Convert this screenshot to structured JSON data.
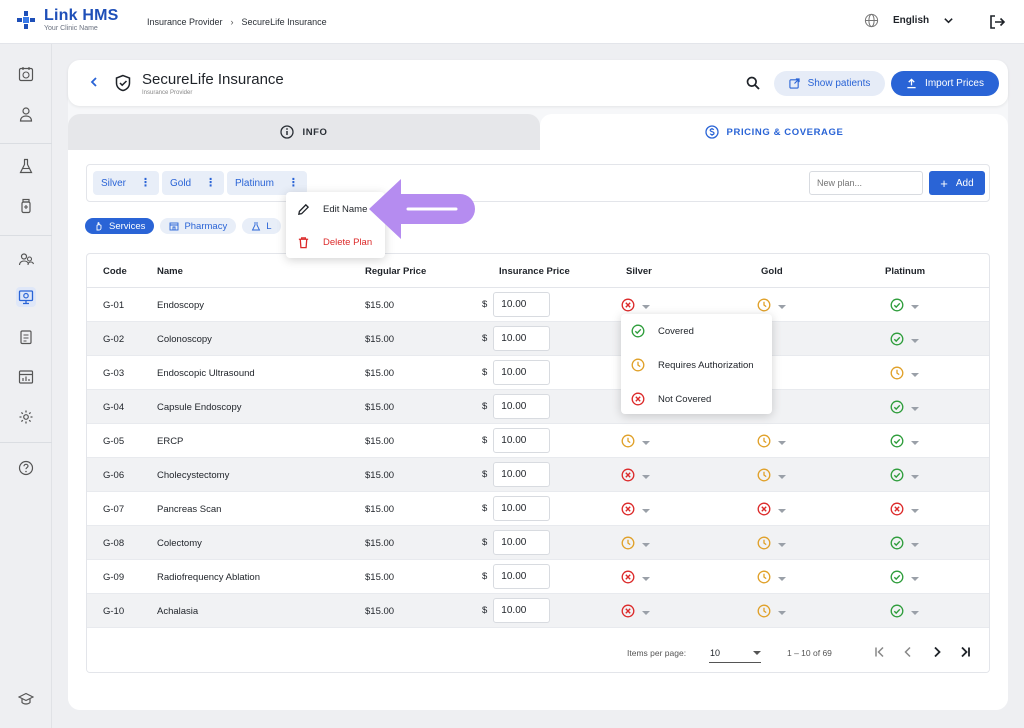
{
  "app": {
    "name": "Link HMS",
    "subtitle": "Your Clinic Name"
  },
  "breadcrumb": [
    "Insurance Provider",
    "SecureLife Insurance"
  ],
  "language": "English",
  "header": {
    "title": "SecureLife Insurance",
    "subtitle": "Insurance Provider",
    "show_patients": "Show patients",
    "import_prices": "Import Prices"
  },
  "tabs": {
    "info": "INFO",
    "pricing": "PRICING & COVERAGE"
  },
  "plans": [
    "Silver",
    "Gold",
    "Platinum"
  ],
  "new_plan_placeholder": "New plan...",
  "add_label": "Add",
  "categories": {
    "services": "Services",
    "pharmacy": "Pharmacy",
    "lab": "L"
  },
  "table": {
    "headers": [
      "Code",
      "Name",
      "Regular Price",
      "Insurance Price",
      "Silver",
      "Gold",
      "Platinum"
    ],
    "currency": "$",
    "rows": [
      {
        "code": "G-01",
        "name": "Endoscopy",
        "regular": "$15.00",
        "insurance": "10.00",
        "silver": "not",
        "gold": "auth",
        "platinum": "covered"
      },
      {
        "code": "G-02",
        "name": "Colonoscopy",
        "regular": "$15.00",
        "insurance": "10.00",
        "silver": "",
        "gold": "",
        "platinum": "covered"
      },
      {
        "code": "G-03",
        "name": "Endoscopic Ultrasound",
        "regular": "$15.00",
        "insurance": "10.00",
        "silver": "",
        "gold": "",
        "platinum": "auth"
      },
      {
        "code": "G-04",
        "name": "Capsule Endoscopy",
        "regular": "$15.00",
        "insurance": "10.00",
        "silver": "",
        "gold": "",
        "platinum": "covered"
      },
      {
        "code": "G-05",
        "name": "ERCP",
        "regular": "$15.00",
        "insurance": "10.00",
        "silver": "auth",
        "gold": "auth",
        "platinum": "covered"
      },
      {
        "code": "G-06",
        "name": "Cholecystectomy",
        "regular": "$15.00",
        "insurance": "10.00",
        "silver": "not",
        "gold": "auth",
        "platinum": "covered"
      },
      {
        "code": "G-07",
        "name": "Pancreas Scan",
        "regular": "$15.00",
        "insurance": "10.00",
        "silver": "not",
        "gold": "not",
        "platinum": "not"
      },
      {
        "code": "G-08",
        "name": "Colectomy",
        "regular": "$15.00",
        "insurance": "10.00",
        "silver": "auth",
        "gold": "auth",
        "platinum": "covered"
      },
      {
        "code": "G-09",
        "name": "Radiofrequency Ablation",
        "regular": "$15.00",
        "insurance": "10.00",
        "silver": "not",
        "gold": "auth",
        "platinum": "covered"
      },
      {
        "code": "G-10",
        "name": "Achalasia",
        "regular": "$15.00",
        "insurance": "10.00",
        "silver": "not",
        "gold": "auth",
        "platinum": "covered"
      }
    ]
  },
  "pagination": {
    "label": "Items per page:",
    "per_page": "10",
    "range": "1 – 10 of 69"
  },
  "plan_menu": {
    "edit": "Edit Name",
    "delete": "Delete Plan"
  },
  "status_menu": {
    "covered": "Covered",
    "auth": "Requires Authorization",
    "not": "Not Covered"
  },
  "colors": {
    "primary": "#2a64d6",
    "covered": "#2e9d3b",
    "auth": "#e0a028",
    "not": "#dc2a2a",
    "arrow": "#b58cf0"
  }
}
